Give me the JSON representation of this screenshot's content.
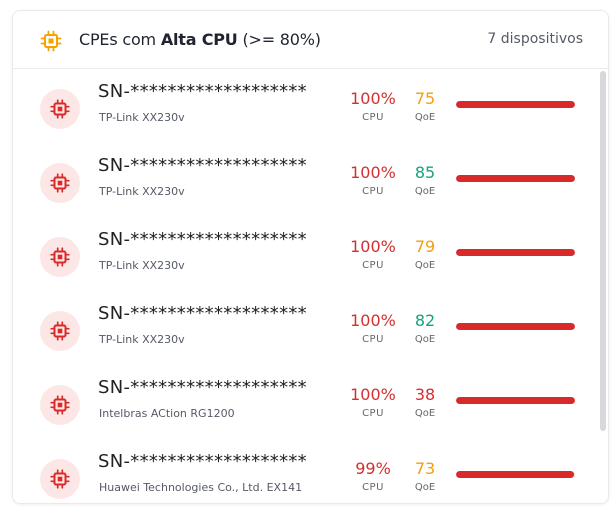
{
  "header": {
    "title_prefix": "CPEs com ",
    "title_bold": "Alta CPU",
    "title_suffix": " (>= 80%)",
    "count": "7 dispositivos",
    "icon": "cpu-chip-icon",
    "icon_color": "#f5a300"
  },
  "labels": {
    "cpu": "CPU",
    "qoe": "QoE"
  },
  "colors": {
    "cpu_red": "#d43030",
    "qoe_orange": "#f59e0b",
    "qoe_green": "#16a37c",
    "qoe_red": "#d43030",
    "bar_red": "#d92a2a",
    "avatar_bg": "#fde6e6"
  },
  "devices": [
    {
      "sn": "SN-*******************",
      "model": "TP-Link XX230v",
      "cpu": "100%",
      "cpu_value": 100,
      "qoe": "75",
      "qoe_status": "orange"
    },
    {
      "sn": "SN-*******************",
      "model": "TP-Link XX230v",
      "cpu": "100%",
      "cpu_value": 100,
      "qoe": "85",
      "qoe_status": "green"
    },
    {
      "sn": "SN-*******************",
      "model": "TP-Link XX230v",
      "cpu": "100%",
      "cpu_value": 100,
      "qoe": "79",
      "qoe_status": "orange"
    },
    {
      "sn": "SN-*******************",
      "model": "TP-Link XX230v",
      "cpu": "100%",
      "cpu_value": 100,
      "qoe": "82",
      "qoe_status": "green"
    },
    {
      "sn": "SN-*******************",
      "model": "Intelbras ACtion RG1200",
      "cpu": "100%",
      "cpu_value": 100,
      "qoe": "38",
      "qoe_status": "red"
    },
    {
      "sn": "SN-*******************",
      "model": "Huawei Technologies Co., Ltd. EX141",
      "cpu": "99%",
      "cpu_value": 99,
      "qoe": "73",
      "qoe_status": "orange"
    }
  ]
}
